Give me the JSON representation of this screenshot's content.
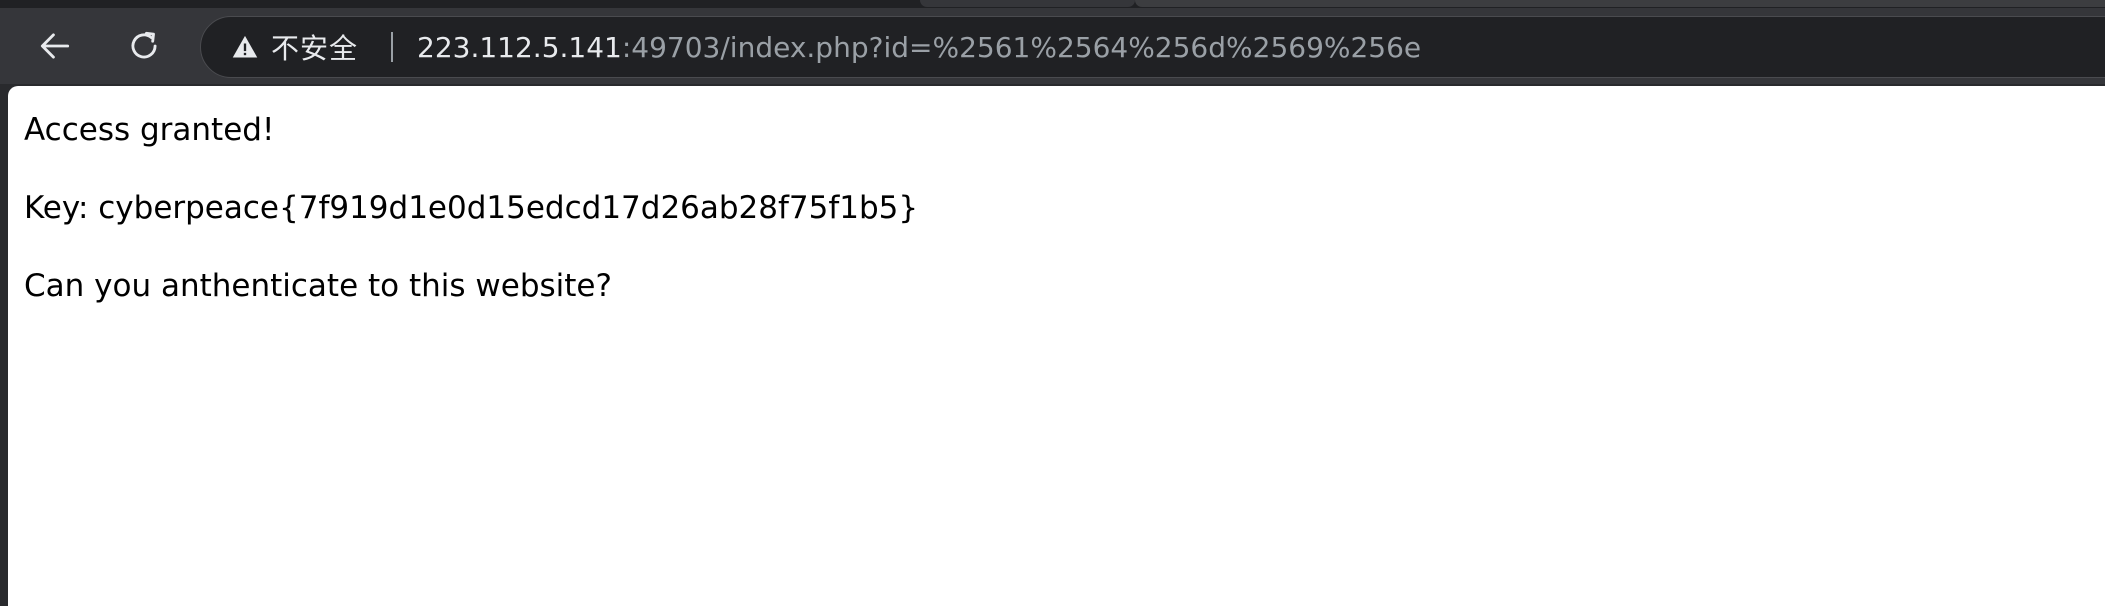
{
  "browser": {
    "security_label": "不安全",
    "url_host": "223.112.5.141",
    "url_rest": ":49703/index.php?id=%2561%2564%256d%2569%256e",
    "icons": {
      "back": "back-arrow-icon",
      "reload": "reload-icon",
      "security": "warning-triangle-icon"
    }
  },
  "page": {
    "line1": "Access granted!",
    "line2": "Key: cyberpeace{7f919d1e0d15edcd17d26ab28f75f1b5}",
    "line3": "Can you anthenticate to this website?"
  }
}
